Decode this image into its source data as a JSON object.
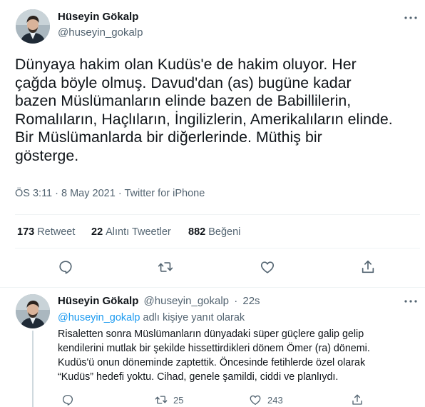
{
  "main_tweet": {
    "author_name": "Hüseyin Gökalp",
    "author_handle": "@huseyin_gokalp",
    "text_lines": [
      "Dünyaya hakim olan Kudüs'e de hakim oluyor. Her",
      "çağda böyle olmuş. Davud'dan (as) bugüne kadar",
      "bazen Müslümanların elinde bazen de Babillilerin,",
      "Romalıların, Haçlıların, İngilizlerin, Amerikalıların elinde.",
      "Bir Müslümanlarda bir diğerlerinde. Müthiş bir",
      "gösterge."
    ],
    "time": "ÖS 3:11",
    "date": "8 May 2021",
    "source": "Twitter for iPhone",
    "separator": "·",
    "stats": {
      "retweets_count": "173",
      "retweets_label": "Retweet",
      "quotes_count": "22",
      "quotes_label": "Alıntı Tweetler",
      "likes_count": "882",
      "likes_label": "Beğeni"
    },
    "icons": [
      "more-icon",
      "reply-icon",
      "retweet-icon",
      "like-icon",
      "share-icon"
    ]
  },
  "reply_tweet": {
    "author_name": "Hüseyin Gökalp",
    "author_handle": "@huseyin_gokalp",
    "separator": "·",
    "time_ago": "22s",
    "replying_mention": "@huseyin_gokalp",
    "replying_suffix": "adlı kişiye yanıt olarak",
    "text_lines": [
      "Risaletten sonra Müslümanların dünyadaki süper güçlere galip gelip",
      "kendilerini mutlak bir şekilde hissettirdikleri dönem Ömer (ra) dönemi.",
      "Kudüs'ü onun döneminde zaptettik. Öncesinde fetihlerde özel olarak",
      "“Kudüs” hedefi yoktu. Cihad, genele şamildi, ciddi ve planlıydı."
    ],
    "retweet_count": "25",
    "like_count": "243"
  },
  "colors": {
    "text_primary": "#0f1419",
    "text_secondary": "#536471",
    "link": "#1d9bf0",
    "divider": "#eff3f4"
  }
}
